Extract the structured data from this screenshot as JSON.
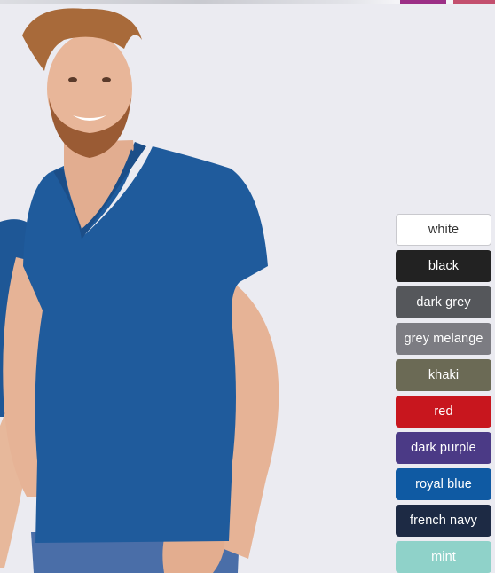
{
  "header": {
    "accent_colors": [
      "#9c2f86",
      "#c34f6e"
    ]
  },
  "product_image": {
    "shirt_color": "#1f5b9c"
  },
  "colors": [
    {
      "label": "white",
      "hex": "#ffffff",
      "light": true
    },
    {
      "label": "black",
      "hex": "#222222"
    },
    {
      "label": "dark grey",
      "hex": "#55575b"
    },
    {
      "label": "grey melange",
      "hex": "#7c7c82"
    },
    {
      "label": "khaki",
      "hex": "#6b6a55"
    },
    {
      "label": "red",
      "hex": "#c8161e"
    },
    {
      "label": "dark purple",
      "hex": "#4b3a86"
    },
    {
      "label": "royal blue",
      "hex": "#0f5aa3"
    },
    {
      "label": "french navy",
      "hex": "#1d2a44"
    },
    {
      "label": "mint",
      "hex": "#8fd2c9"
    }
  ]
}
